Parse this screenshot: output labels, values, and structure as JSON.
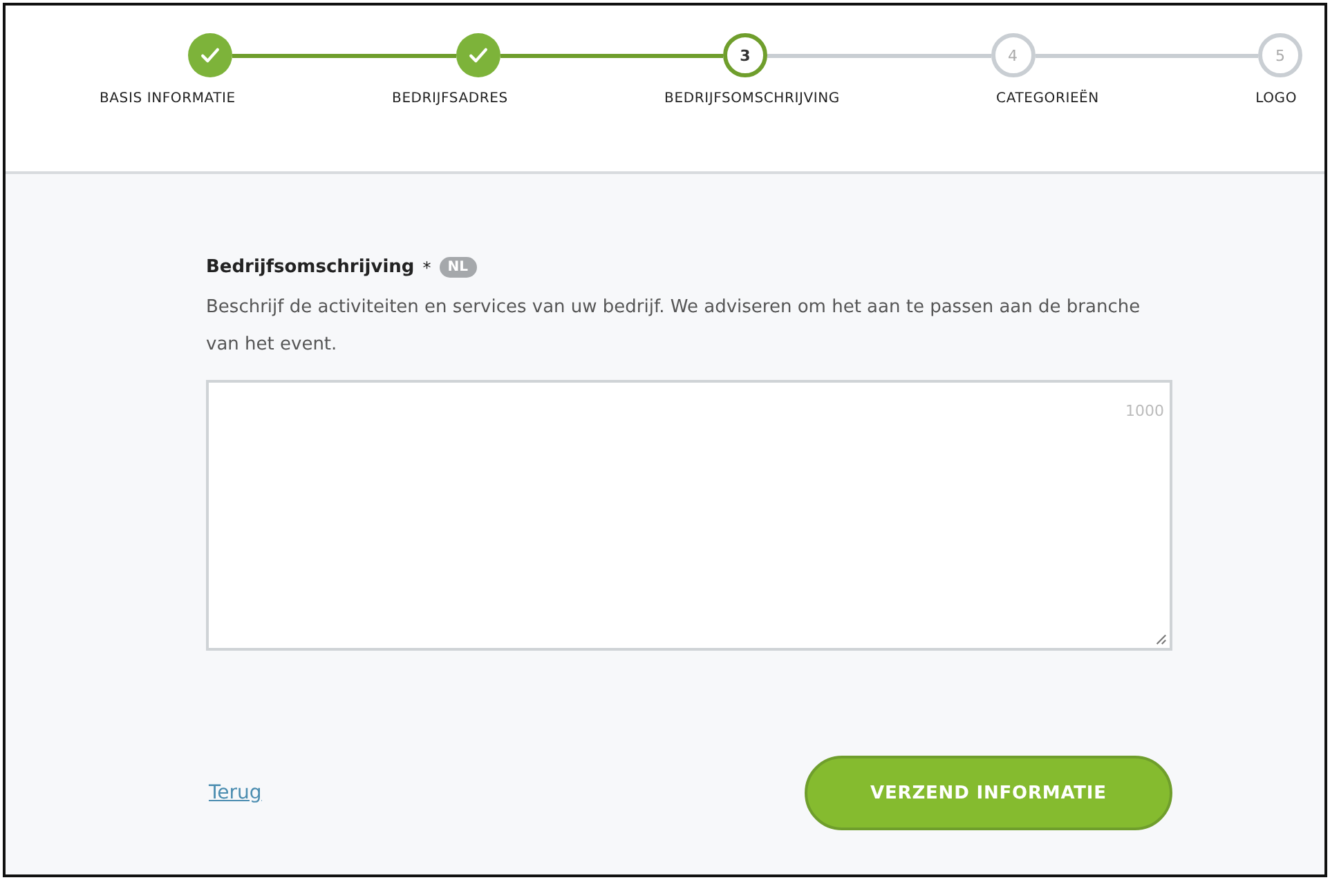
{
  "steps": [
    {
      "label": "BASIS INFORMATIE",
      "kind": "done"
    },
    {
      "label": "BEDRIJFSADRES",
      "kind": "done"
    },
    {
      "number": "3",
      "label": "BEDRIJFSOMSCHRIJVING",
      "kind": "current"
    },
    {
      "number": "4",
      "label": "CATEGORIEËN",
      "kind": "todo"
    },
    {
      "number": "5",
      "label": "LOGO",
      "kind": "todo"
    }
  ],
  "field": {
    "label": "Bedrijfsomschrijving",
    "required_mark": "*",
    "language_badge": "NL",
    "help": "Beschrijf de activiteiten en services van uw bedrijf. We adviseren om het aan te passen aan de branche van het event.",
    "counter": "1000"
  },
  "back_link": "Terug",
  "submit_button": "VERZEND INFORMATIE"
}
